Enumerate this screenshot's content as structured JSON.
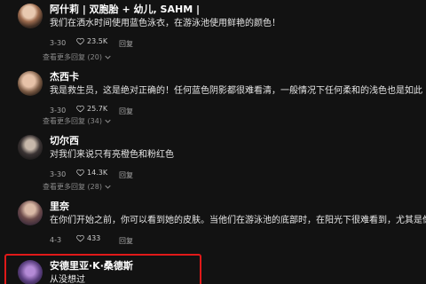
{
  "comments": [
    {
      "username": "阿什莉 | 双胞胎 + 幼儿, SAHM |",
      "text": "我们在洒水时间使用蓝色泳衣，在游泳池使用鲜艳的颜色！",
      "date": "3-30",
      "likes": "23.5K",
      "reply_label": "回复",
      "more_replies": "查看更多回复 (20)"
    },
    {
      "username": "杰西卡",
      "text": "我是救生员，这是绝对正确的！任何蓝色阴影都很难看清，一般情况下任何柔和的浅色也是如此",
      "date": "3-30",
      "likes": "25.7K",
      "reply_label": "回复",
      "more_replies": "查看更多回复 (34)"
    },
    {
      "username": "切尔西",
      "text": "对我们来说只有亮橙色和粉红色",
      "date": "3-30",
      "likes": "14.3K",
      "reply_label": "回复",
      "more_replies": "查看更多回复 (28)"
    },
    {
      "username": "里奈",
      "text": "在你们开始之前，你可以看到她的皮肤。当他们在游泳池的底部时，在阳光下很难看到，尤其是像她说的",
      "date": "4-3",
      "likes": "433",
      "reply_label": "回复",
      "more_replies": ""
    },
    {
      "username": "安德里亚·K·桑德斯",
      "text": "从没想过",
      "date": "",
      "likes": "",
      "reply_label": "",
      "more_replies": ""
    }
  ],
  "colors": {
    "background": "#121212",
    "highlight_border": "#e01919",
    "muted_text": "#a8a8a8"
  },
  "icons": {
    "like": "heart-outline-icon",
    "expand": "chevron-down-icon"
  }
}
